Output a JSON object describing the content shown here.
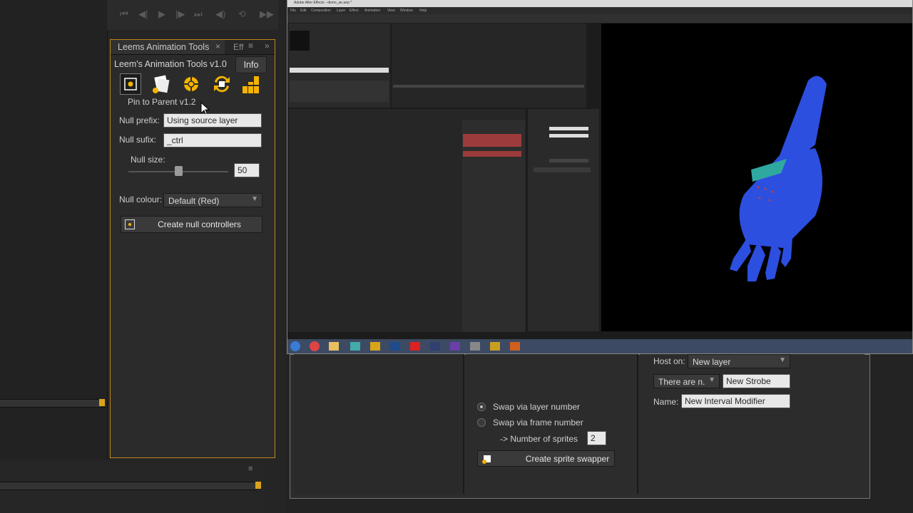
{
  "tool_panel": {
    "tab_label": "Leems Animation Tools",
    "tab_close": "×",
    "eff_tab": "Eff",
    "title": "Leem's Animation Tools v1.0",
    "info_label": "Info",
    "subtitle": "Pin to Parent v1.2",
    "null_prefix_label": "Null prefix:",
    "null_prefix_value": "Using source layer name",
    "null_suffix_label": "Null sufix:",
    "null_suffix_value": "_ctrl",
    "null_size_label": "Null size:",
    "null_size_value": "50",
    "null_size_fraction": 0.5,
    "null_colour_label": "Null colour:",
    "null_colour_value": "Default (Red)",
    "create_button": "Create null controllers"
  },
  "right_tools": {
    "swap_layer_label": "Swap via layer number",
    "swap_frame_label": "Swap via frame number",
    "sprites_label": "-> Number of sprites",
    "sprites_value": "2",
    "create_sprite_button": "Create sprite swapper",
    "host_label": "Host on:",
    "host_value": "New layer",
    "there_are_value": "There are n.",
    "strobe_value": "New Strobe Cont",
    "name_label": "Name:",
    "name_value": "New Interval Modifier"
  },
  "inner_app": {
    "title": "Adobe After Effects - demo_ae.aep *",
    "menus": [
      "File",
      "Edit",
      "Composition",
      "Layer",
      "Effect",
      "Animation",
      "View",
      "Window",
      "Help"
    ]
  },
  "colors": {
    "accent_orange": "#c0851b",
    "knob_orange": "#d9a31a",
    "panel_bg": "#2b2b2b",
    "hand_blue": "#2c4fe0"
  }
}
